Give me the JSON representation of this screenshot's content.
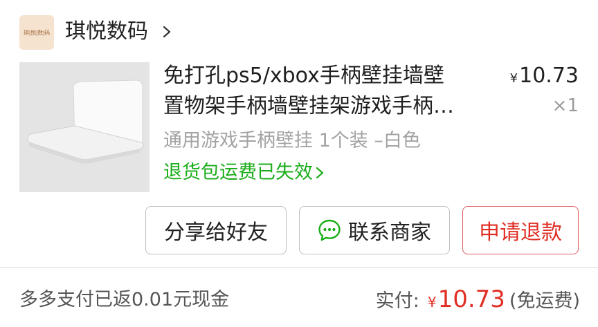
{
  "shop": {
    "logo_text": "琪|悦|数|码",
    "name": "琪悦数码",
    "chevron_icon": "chevron-right-icon"
  },
  "product": {
    "image_icon": "controller-wall-mount-image",
    "title_line1": "免打孔ps5/xbox手柄壁挂墙壁",
    "title_line2": "置物架手柄墙壁挂架游戏手柄…",
    "price_symbol": "¥",
    "price": "10.73",
    "quantity": "×1",
    "spec": "通用游戏手柄壁挂 1个装 –白色",
    "return_note": "退货包运费已失效",
    "return_note_color": "#1aad19"
  },
  "actions": {
    "share_label": "分享给好友",
    "contact_label": "联系商家",
    "contact_icon": "chat-bubble-icon",
    "refund_label": "申请退款",
    "refund_color": "#e02e24"
  },
  "footer": {
    "cashback_text": "多多支付已返0.01元现金",
    "paid_label": "实付:",
    "paid_symbol": "¥",
    "paid_amount": "10.73",
    "shipping_note": "(免运费)"
  }
}
